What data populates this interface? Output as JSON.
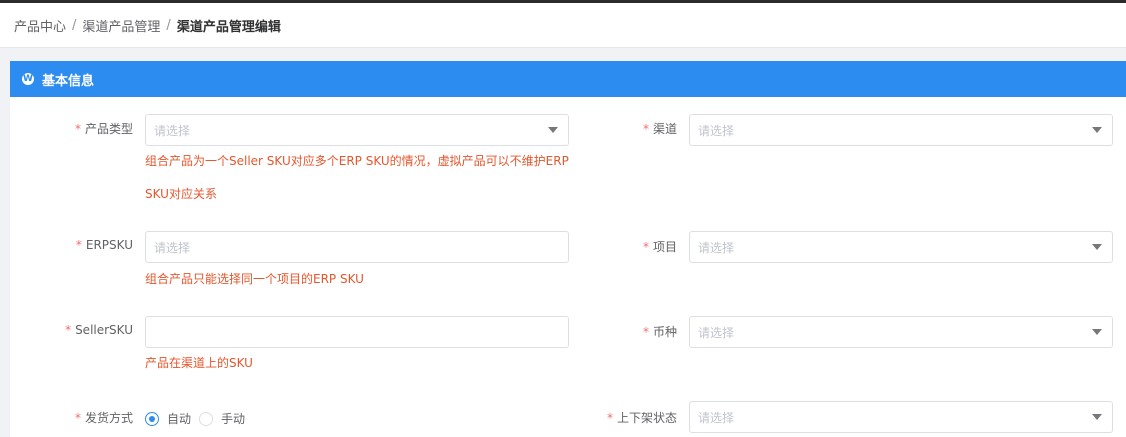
{
  "breadcrumb": {
    "items": [
      "产品中心",
      "渠道产品管理",
      "渠道产品管理编辑"
    ],
    "separator": "/"
  },
  "section": {
    "title": "基本信息"
  },
  "required_mark": "*",
  "fields": {
    "product_type": {
      "label": "产品类型",
      "placeholder": "请选择",
      "hint_line1": "组合产品为一个Seller SKU对应多个ERP SKU的情况，虚拟产品可以不维护ERP",
      "hint_line2": "SKU对应关系"
    },
    "channel": {
      "label": "渠道",
      "placeholder": "请选择"
    },
    "erpsku": {
      "label": "ERPSKU",
      "placeholder": "请选择",
      "hint": "组合产品只能选择同一个项目的ERP SKU"
    },
    "project": {
      "label": "项目",
      "placeholder": "请选择"
    },
    "sellersku": {
      "label": "SellerSKU",
      "value": "",
      "hint": "产品在渠道上的SKU"
    },
    "currency": {
      "label": "币种",
      "placeholder": "请选择"
    },
    "shipping": {
      "label": "发货方式",
      "options": [
        "自动",
        "手动"
      ],
      "selected": "自动"
    },
    "listing_status": {
      "label": "上下架状态",
      "placeholder": "请选择"
    }
  },
  "colors": {
    "accent": "#2d8cf0",
    "hint": "#e4572e",
    "required": "#f56c6c"
  }
}
